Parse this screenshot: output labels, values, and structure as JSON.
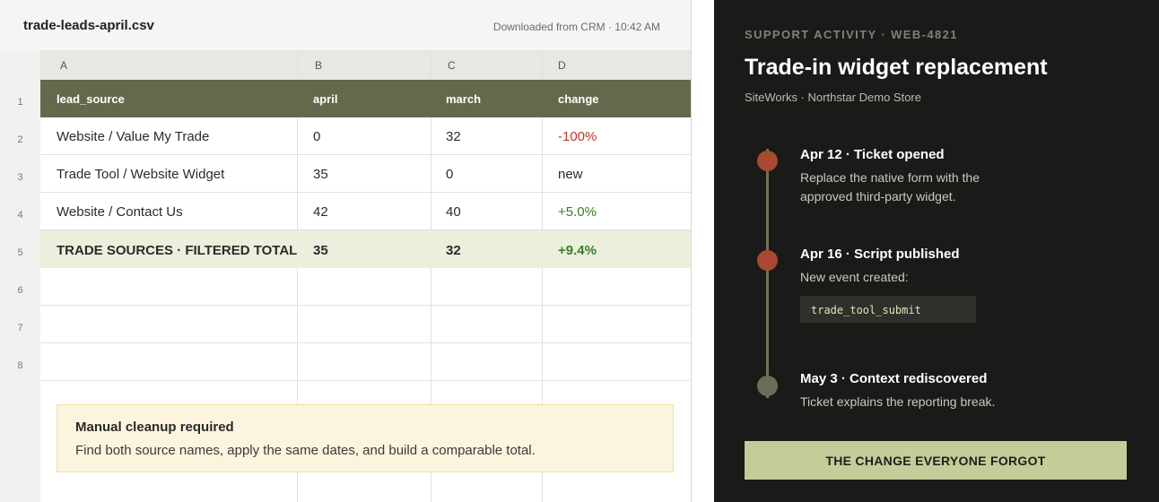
{
  "file": {
    "name": "trade-leads-april.csv",
    "downloaded": "Downloaded from CRM · 10:42 AM"
  },
  "columns": [
    "A",
    "B",
    "C",
    "D"
  ],
  "row_numbers": [
    "1",
    "2",
    "3",
    "4",
    "5",
    "6",
    "7",
    "8"
  ],
  "table": {
    "headers": [
      "lead_source",
      "april",
      "march",
      "change"
    ],
    "rows": [
      {
        "lead_source": "Website / Value My Trade",
        "april": "0",
        "march": "32",
        "change": "-100%"
      },
      {
        "lead_source": "Trade Tool / Website Widget",
        "april": "35",
        "march": "0",
        "change": "new"
      },
      {
        "lead_source": "Website / Contact Us",
        "april": "42",
        "march": "40",
        "change": "+5.0%"
      }
    ],
    "total": {
      "lead_source": "TRADE SOURCES · FILTERED TOTAL",
      "april": "35",
      "march": "32",
      "change": "+9.4%"
    }
  },
  "note": {
    "title": "Manual cleanup required",
    "body": "Find both source names, apply the same dates, and build a comparable total."
  },
  "colors": {
    "header_fill": "#65694c",
    "total_fill": "#eaf0dc",
    "negative": "#b53a2a",
    "positive": "#3b7a2e",
    "panel_bg": "#1a1b18",
    "timeline_dot_red": "#a84a31",
    "banner_fill": "#c5cc9a"
  },
  "panel": {
    "kicker": "SUPPORT ACTIVITY · WEB-4821",
    "title": "Trade-in widget replacement",
    "subtitle": "SiteWorks · Northstar Demo Store",
    "events": [
      {
        "title": "Apr 12 · Ticket opened",
        "body": "Replace the native form with the approved third-party widget."
      },
      {
        "title": "Apr 16 · Script published",
        "body": "New event created:",
        "code": "trade_tool_submit"
      },
      {
        "title": "May 3 · Context rediscovered",
        "body": "Ticket explains the reporting break."
      }
    ],
    "banner": "THE CHANGE EVERYONE FORGOT"
  }
}
